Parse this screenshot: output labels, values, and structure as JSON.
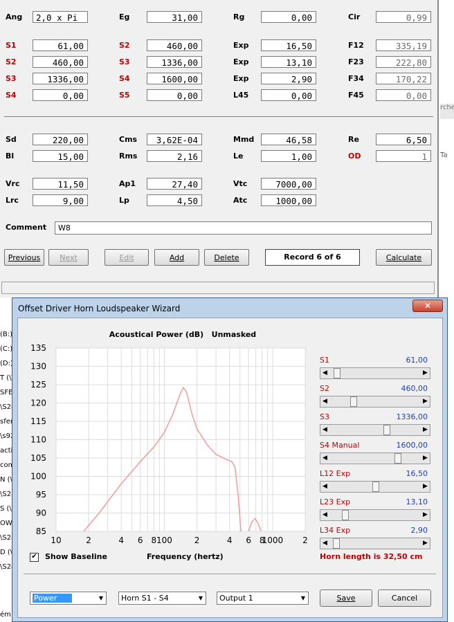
{
  "main": {
    "params": {
      "Ang": {
        "label": "Ang",
        "value": "2,0 x Pi"
      },
      "Eg": {
        "label": "Eg",
        "value": "31,00"
      },
      "Rg": {
        "label": "Rg",
        "value": "0,00"
      },
      "Cir": {
        "label": "Cir",
        "value": "0,99"
      },
      "S1a": {
        "label": "S1",
        "value": "61,00"
      },
      "S2a": {
        "label": "S2",
        "value": "460,00"
      },
      "Exp1": {
        "label": "Exp",
        "value": "16,50"
      },
      "F12": {
        "label": "F12",
        "value": "335,19"
      },
      "S2b": {
        "label": "S2",
        "value": "460,00"
      },
      "S3a": {
        "label": "S3",
        "value": "1336,00"
      },
      "Exp2": {
        "label": "Exp",
        "value": "13,10"
      },
      "F23": {
        "label": "F23",
        "value": "222,80"
      },
      "S3b": {
        "label": "S3",
        "value": "1336,00"
      },
      "S4a": {
        "label": "S4",
        "value": "1600,00"
      },
      "Exp3": {
        "label": "Exp",
        "value": "2,90"
      },
      "F34": {
        "label": "F34",
        "value": "170,22"
      },
      "S4b": {
        "label": "S4",
        "value": "0,00"
      },
      "S5": {
        "label": "S5",
        "value": "0,00"
      },
      "L45": {
        "label": "L45",
        "value": "0,00"
      },
      "F45": {
        "label": "F45",
        "value": "0,00"
      },
      "Sd": {
        "label": "Sd",
        "value": "220,00"
      },
      "Cms": {
        "label": "Cms",
        "value": "3,62E-04"
      },
      "Mmd": {
        "label": "Mmd",
        "value": "46,58"
      },
      "Re": {
        "label": "Re",
        "value": "6,50"
      },
      "Bl": {
        "label": "Bl",
        "value": "15,00"
      },
      "Rms": {
        "label": "Rms",
        "value": "2,16"
      },
      "Le": {
        "label": "Le",
        "value": "1,00"
      },
      "OD": {
        "label": "OD",
        "value": "1"
      },
      "Vrc": {
        "label": "Vrc",
        "value": "11,50"
      },
      "Ap1": {
        "label": "Ap1",
        "value": "27,40"
      },
      "Vtc": {
        "label": "Vtc",
        "value": "7000,00"
      },
      "Lrc": {
        "label": "Lrc",
        "value": "9,00"
      },
      "Lp": {
        "label": "Lp",
        "value": "4,50"
      },
      "Atc": {
        "label": "Atc",
        "value": "1000,00"
      }
    },
    "comment": {
      "label": "Comment",
      "value": "W8"
    },
    "buttons": {
      "previous": "Previous",
      "next": "Next",
      "edit": "Edit",
      "add": "Add",
      "delete": "Delete",
      "calculate": "Calculate"
    },
    "record": "Record 6 of 6"
  },
  "side_fragments": [
    "(B:)",
    "(C:)",
    "(D:)",
    "T (\\\\",
    "SFE",
    "\\S24",
    "sfer",
    "\\s92",
    "acti",
    "com",
    "N (\\\\",
    "\\S24",
    "S (\\\\",
    "OWE",
    "\\S24",
    "D (\\\\",
    "\\S24",
    "ém"
  ],
  "right_fragments": [
    "rche",
    "Ta"
  ],
  "wizard": {
    "title": "Offset Driver Horn Loudspeaker Wizard",
    "close": "✕",
    "chart_title": "Acoustical Power (dB)   Unmasked",
    "show_baseline": "Show Baseline",
    "baseline_checked": true,
    "freq_label": "Frequency (hertz)",
    "horn_length": "Horn length is 32,50 cm",
    "combos": {
      "mode": "Power",
      "horn": "Horn S1 - S4",
      "output": "Output 1"
    },
    "save": "Save",
    "cancel": "Cancel",
    "sliders": [
      {
        "label": "S1",
        "value": "61,00",
        "position": 0.05
      },
      {
        "label": "S2",
        "value": "460,00",
        "position": 0.25
      },
      {
        "label": "S3",
        "value": "1336,00",
        "position": 0.65
      },
      {
        "label": "S4  Manual",
        "value": "1600,00",
        "position": 0.78
      },
      {
        "label": "L12  Exp",
        "value": "16,50",
        "position": 0.52
      },
      {
        "label": "L23  Exp",
        "value": "13,10",
        "position": 0.15
      },
      {
        "label": "L34  Exp",
        "value": "2,90",
        "position": 0.04
      }
    ]
  },
  "chart_data": {
    "type": "line",
    "title": "Acoustical Power (dB)   Unmasked",
    "xlabel": "Frequency (hertz)",
    "ylabel": "",
    "xscale": "log",
    "xlim": [
      10,
      2000
    ],
    "ylim": [
      85,
      135
    ],
    "yticks": [
      85,
      90,
      95,
      100,
      105,
      110,
      115,
      120,
      125,
      130,
      135
    ],
    "xtick_labels": [
      {
        "v": 10,
        "t": "10"
      },
      {
        "v": 20,
        "t": "2"
      },
      {
        "v": 40,
        "t": "4"
      },
      {
        "v": 60,
        "t": "6"
      },
      {
        "v": 80,
        "t": "8"
      },
      {
        "v": 100,
        "t": "100"
      },
      {
        "v": 200,
        "t": "2"
      },
      {
        "v": 400,
        "t": "4"
      },
      {
        "v": 600,
        "t": "6"
      },
      {
        "v": 800,
        "t": "8"
      },
      {
        "v": 1000,
        "t": "1000"
      },
      {
        "v": 2000,
        "t": "2"
      }
    ],
    "grid": true,
    "line_color": "#f2a0a0",
    "series": [
      {
        "points": [
          [
            18,
            85
          ],
          [
            25,
            90
          ],
          [
            40,
            98
          ],
          [
            60,
            104
          ],
          [
            80,
            108
          ],
          [
            100,
            112
          ],
          [
            120,
            117
          ],
          [
            140,
            122.5
          ],
          [
            150,
            124.2
          ],
          [
            160,
            123
          ],
          [
            180,
            117
          ],
          [
            200,
            113
          ],
          [
            250,
            108.5
          ],
          [
            300,
            106
          ],
          [
            380,
            104.5
          ],
          [
            420,
            104
          ],
          [
            450,
            102.5
          ],
          [
            480,
            95
          ],
          [
            510,
            85
          ]
        ]
      },
      {
        "points": [
          [
            600,
            85
          ],
          [
            640,
            87.5
          ],
          [
            690,
            88.5
          ],
          [
            740,
            87
          ],
          [
            780,
            85
          ]
        ]
      }
    ]
  }
}
